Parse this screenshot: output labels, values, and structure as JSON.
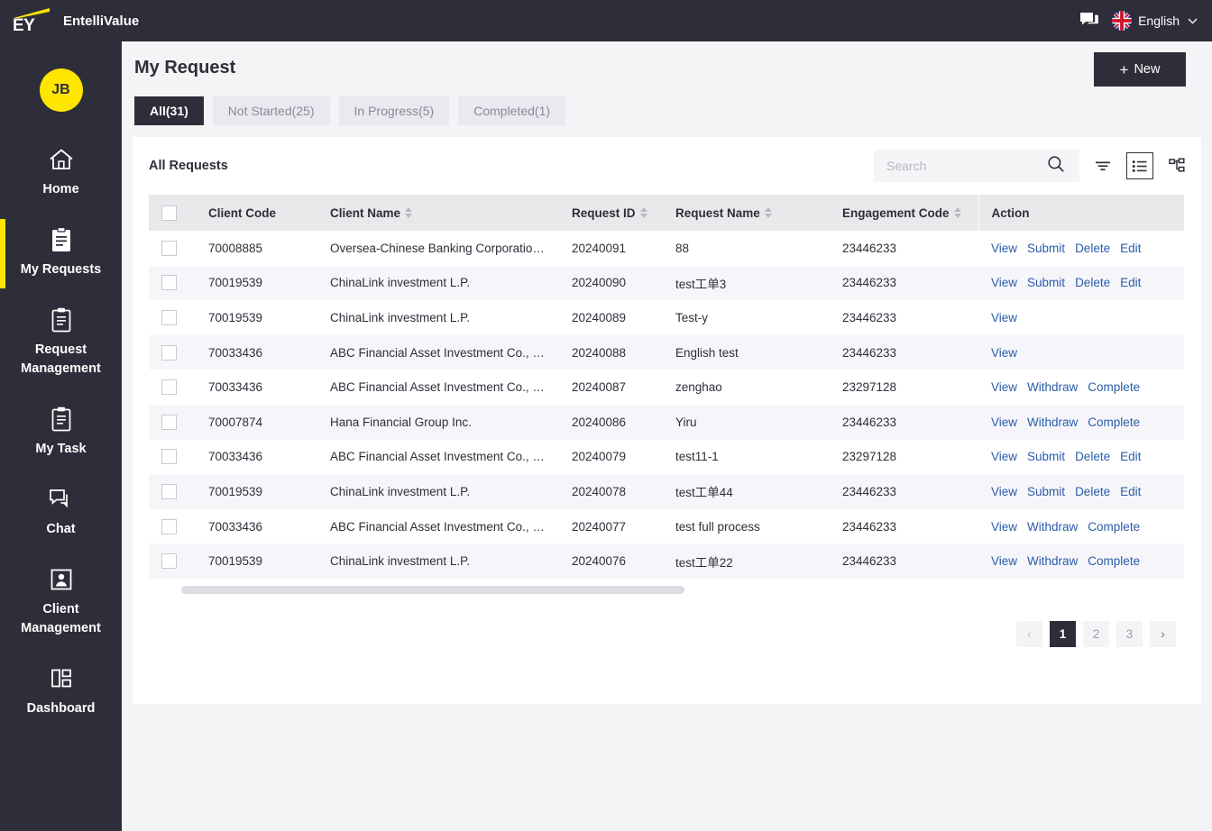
{
  "brand": {
    "logo_text": "EY",
    "app_name": "EntelliValue",
    "accent": "#ffe600",
    "dark": "#2e2e3a"
  },
  "topbar": {
    "chat_icon": "chat-icon",
    "language": "English",
    "language_flag": "uk-flag-icon",
    "chevron": "∨"
  },
  "sidebar": {
    "avatar_initials": "JB",
    "items": [
      {
        "label": "Home",
        "icon": "home-icon",
        "active": false
      },
      {
        "label": "My Requests",
        "icon": "clipboard-filled-icon",
        "active": true
      },
      {
        "label": "Request Management",
        "icon": "clipboard-list-icon",
        "active": false
      },
      {
        "label": "My Task",
        "icon": "clipboard-task-icon",
        "active": false
      },
      {
        "label": "Chat",
        "icon": "chat-bubbles-icon",
        "active": false
      },
      {
        "label": "Client Management",
        "icon": "user-frame-icon",
        "active": false
      },
      {
        "label": "Dashboard",
        "icon": "dashboard-grid-icon",
        "active": false
      }
    ]
  },
  "page": {
    "title": "My Request",
    "new_button": "New",
    "new_button_plus": "+",
    "tabs": [
      {
        "label": "All(31)",
        "active": true
      },
      {
        "label": "Not Started(25)",
        "active": false
      },
      {
        "label": "In Progress(5)",
        "active": false
      },
      {
        "label": "Completed(1)",
        "active": false
      }
    ]
  },
  "card": {
    "title": "All Requests",
    "search": {
      "value": "",
      "placeholder": "Search",
      "icon": "search-icon"
    },
    "icons": [
      {
        "name": "filter-icon",
        "active": false
      },
      {
        "name": "list-view-icon",
        "active": true
      },
      {
        "name": "tree-view-icon",
        "active": false
      }
    ]
  },
  "table": {
    "columns": [
      {
        "label": "",
        "sortable": false,
        "name": "select-all"
      },
      {
        "label": "Client Code",
        "sortable": false
      },
      {
        "label": "Client Name",
        "sortable": true
      },
      {
        "label": "Request ID",
        "sortable": true
      },
      {
        "label": "Request Name",
        "sortable": true
      },
      {
        "label": "Engagement Code",
        "sortable": true
      },
      {
        "label": "Action",
        "sortable": false
      }
    ],
    "rows": [
      {
        "client_code": "70008885",
        "client_name": "Oversea-Chinese Banking Corporatio…",
        "request_id": "20240091",
        "request_name": "88",
        "engagement_code": "23446233",
        "actions": [
          "View",
          "Submit",
          "Delete",
          "Edit"
        ]
      },
      {
        "client_code": "70019539",
        "client_name": "ChinaLink investment L.P.",
        "request_id": "20240090",
        "request_name": "test工单3",
        "engagement_code": "23446233",
        "actions": [
          "View",
          "Submit",
          "Delete",
          "Edit"
        ]
      },
      {
        "client_code": "70019539",
        "client_name": "ChinaLink investment L.P.",
        "request_id": "20240089",
        "request_name": "Test-y",
        "engagement_code": "23446233",
        "actions": [
          "View"
        ]
      },
      {
        "client_code": "70033436",
        "client_name": "ABC Financial Asset Investment Co., …",
        "request_id": "20240088",
        "request_name": "English test",
        "engagement_code": "23446233",
        "actions": [
          "View"
        ]
      },
      {
        "client_code": "70033436",
        "client_name": "ABC Financial Asset Investment Co., …",
        "request_id": "20240087",
        "request_name": "zenghao",
        "engagement_code": "23297128",
        "actions": [
          "View",
          "Withdraw",
          "Complete"
        ]
      },
      {
        "client_code": "70007874",
        "client_name": "Hana Financial Group Inc.",
        "request_id": "20240086",
        "request_name": "Yiru",
        "engagement_code": "23446233",
        "actions": [
          "View",
          "Withdraw",
          "Complete"
        ]
      },
      {
        "client_code": "70033436",
        "client_name": "ABC Financial Asset Investment Co., …",
        "request_id": "20240079",
        "request_name": "test11-1",
        "engagement_code": "23297128",
        "actions": [
          "View",
          "Submit",
          "Delete",
          "Edit"
        ]
      },
      {
        "client_code": "70019539",
        "client_name": "ChinaLink investment L.P.",
        "request_id": "20240078",
        "request_name": "test工单44",
        "engagement_code": "23446233",
        "actions": [
          "View",
          "Submit",
          "Delete",
          "Edit"
        ]
      },
      {
        "client_code": "70033436",
        "client_name": "ABC Financial Asset Investment Co., …",
        "request_id": "20240077",
        "request_name": "test full process",
        "engagement_code": "23446233",
        "actions": [
          "View",
          "Withdraw",
          "Complete"
        ]
      },
      {
        "client_code": "70019539",
        "client_name": "ChinaLink investment L.P.",
        "request_id": "20240076",
        "request_name": "test工单22",
        "engagement_code": "23446233",
        "actions": [
          "View",
          "Withdraw",
          "Complete"
        ]
      }
    ]
  },
  "pagination": {
    "prev": "‹",
    "next": "›",
    "pages": [
      "1",
      "2",
      "3"
    ],
    "current": "1"
  }
}
